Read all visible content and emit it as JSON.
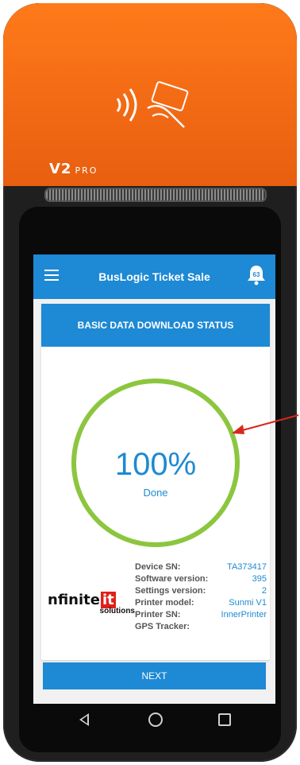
{
  "device": {
    "brand": "V2",
    "model_suffix": "PRO",
    "shell_color": "#ff7a1a"
  },
  "appbar": {
    "title": "BusLogic Ticket Sale",
    "notification_count": "63",
    "menu_icon": "hamburger-menu-icon",
    "bell_icon": "bell-icon"
  },
  "status_card": {
    "header": "BASIC DATA DOWNLOAD STATUS",
    "progress_label": "100%",
    "progress_value": 1.0,
    "status_text": "Done",
    "ring_color": "#8cc63f"
  },
  "info": [
    {
      "label": "Device SN:",
      "value": "TA373417"
    },
    {
      "label": "Software version:",
      "value": "395"
    },
    {
      "label": "Settings version:",
      "value": "2"
    },
    {
      "label": "Printer model:",
      "value": "Sunmi V1"
    },
    {
      "label": "Printer SN:",
      "value": "InnerPrinter"
    },
    {
      "label": "GPS Tracker:",
      "value": ""
    }
  ],
  "logo": {
    "main": "nfinite",
    "highlight": "it",
    "sub": "solutions"
  },
  "next_button": {
    "label": "NEXT"
  },
  "colors": {
    "accent": "#1e89d4",
    "annotation": "#d9261c"
  }
}
